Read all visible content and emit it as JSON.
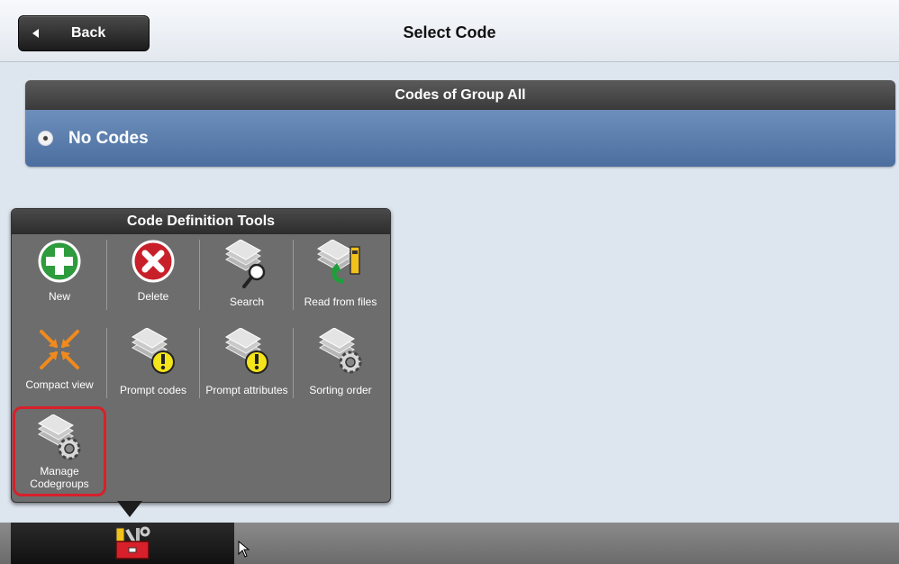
{
  "header": {
    "back_label": "Back",
    "title": "Select Code"
  },
  "codes_panel": {
    "title": "Codes of Group All",
    "items": [
      "No Codes"
    ]
  },
  "tools_popup": {
    "title": "Code Definition Tools",
    "tools": [
      {
        "label": "New",
        "icon": "plus-icon"
      },
      {
        "label": "Delete",
        "icon": "delete-icon"
      },
      {
        "label": "Search",
        "icon": "search-icon"
      },
      {
        "label": "Read from files",
        "icon": "read-files-icon"
      },
      {
        "label": "Compact view",
        "icon": "compact-icon"
      },
      {
        "label": "Prompt codes",
        "icon": "prompt-codes-icon"
      },
      {
        "label": "Prompt attributes",
        "icon": "prompt-attributes-icon"
      },
      {
        "label": "Sorting order",
        "icon": "sorting-icon"
      },
      {
        "label": "Manage Codegroups",
        "icon": "manage-icon"
      }
    ]
  },
  "colors": {
    "accent_blue": "#5b7fb0",
    "highlight": "#d8202a",
    "new_green": "#2e9b3c",
    "delete_red": "#c8202a"
  }
}
